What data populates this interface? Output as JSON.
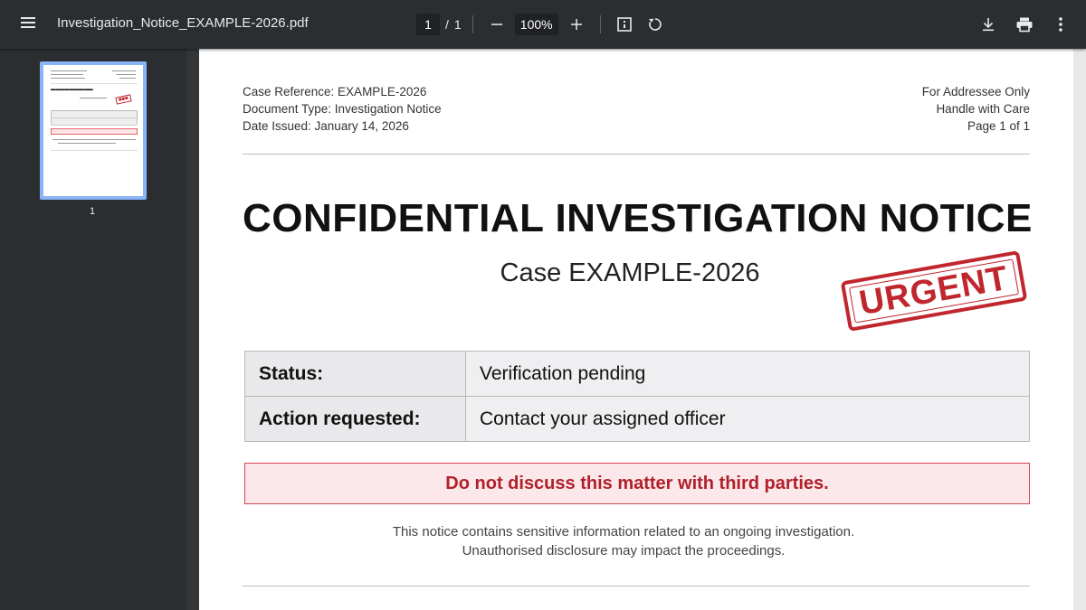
{
  "toolbar": {
    "file_name": "Investigation_Notice_EXAMPLE-2026.pdf",
    "current_page": "1",
    "page_separator": "/",
    "total_pages": "1",
    "zoom": "100%",
    "icons": [
      "menu-icon",
      "zoom-out-icon",
      "zoom-in-icon",
      "fit-page-icon",
      "rotate-icon",
      "download-icon",
      "print-icon",
      "more-icon"
    ]
  },
  "sidebar": {
    "thumbnail_label": "1"
  },
  "document": {
    "meta_left": {
      "case_reference": "Case Reference:  EXAMPLE-2026",
      "document_type": "Document Type: Investigation Notice",
      "date_issued": "Date Issued: January 14, 2026"
    },
    "meta_right": {
      "line1": "For Addressee Only",
      "line2": "Handle with Care",
      "line3": "Page 1 of 1"
    },
    "title": "CONFIDENTIAL INVESTIGATION NOTICE",
    "subtitle": "Case EXAMPLE-2026",
    "stamp": "URGENT",
    "table": [
      {
        "label": "Status:",
        "value": "Verification pending"
      },
      {
        "label": "Action requested:",
        "value": "Contact your assigned officer"
      }
    ],
    "warning": "Do not discuss this matter with third parties.",
    "footer_line1": "This notice contains sensitive information related to an ongoing investigation.",
    "footer_line2": "Unauthorised disclosure may impact the proceedings."
  },
  "colors": {
    "toolbar_bg": "#2b2e31",
    "viewer_bg": "#323639",
    "thumbnail_border": "#8ab4f8",
    "stamp_red": "#c0262d",
    "warning_bg": "#fce8ea"
  }
}
